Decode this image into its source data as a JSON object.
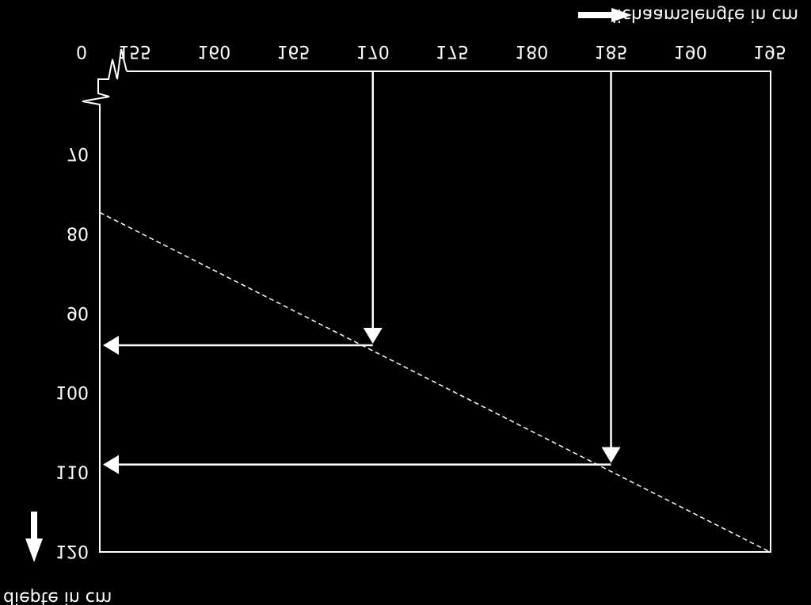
{
  "chart_data": {
    "type": "line",
    "orientation": "vertically mirrored (upside-down text)",
    "xlabel": "lichaamslengte in cm",
    "ylabel": "diepte in cm",
    "x_ticks": [
      "155",
      "160",
      "165",
      "170",
      "175",
      "180",
      "185",
      "190",
      "195"
    ],
    "x_tick_values": [
      155,
      160,
      165,
      170,
      175,
      180,
      185,
      190,
      195
    ],
    "y_ticks": [
      "70",
      "80",
      "90",
      "100",
      "110",
      "120"
    ],
    "y_tick_values": [
      70,
      80,
      90,
      100,
      110,
      120
    ],
    "origin_label": "0",
    "xlim": [
      152.8,
      195
    ],
    "ylim": [
      60,
      120
    ],
    "axis_breaks": true,
    "grid": false,
    "series": [
      {
        "style": "dashed",
        "points": [
          [
            152.8,
            77.3
          ],
          [
            195,
            120
          ]
        ]
      }
    ],
    "readings": [
      {
        "x": 170,
        "y": 95
      },
      {
        "x": 185,
        "y": 110
      }
    ],
    "colors": {
      "background": "#000000",
      "foreground": "#ffffff"
    }
  }
}
